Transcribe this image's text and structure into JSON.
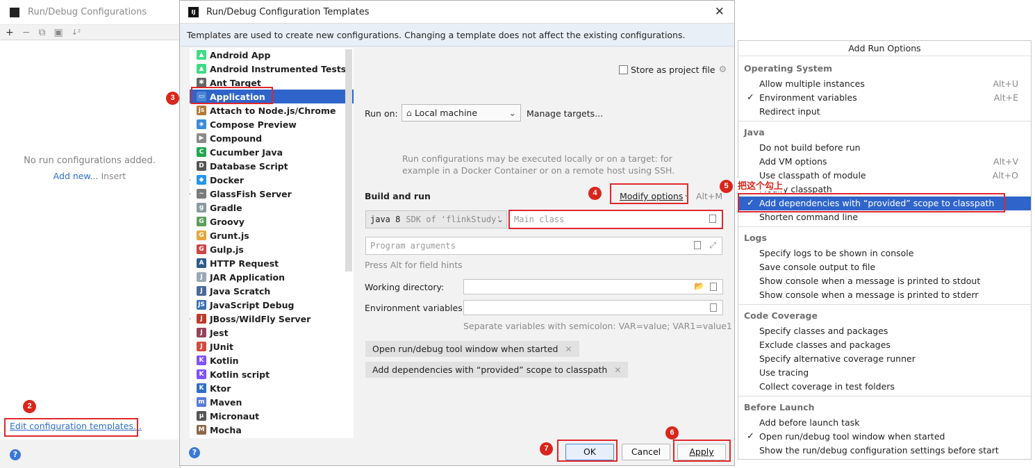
{
  "background_window": {
    "title": "Run/Debug Configurations",
    "toolbar": [
      "+",
      "−",
      "⧉",
      "▣",
      "↓²"
    ],
    "empty_text": "No run configurations added.",
    "add_new": "Add new...",
    "insert_hint": "Insert",
    "edit_templates_link": "Edit configuration templates..."
  },
  "dialog": {
    "title": "Run/Debug Configuration Templates",
    "banner": "Templates are used to create new configurations. Changing a template does not affect the existing configurations.",
    "tree": [
      {
        "label": "Android App",
        "icon": "android-icon",
        "color": "#3ddc84"
      },
      {
        "label": "Android Instrumented Tests",
        "icon": "android-test-icon",
        "color": "#3ddc84"
      },
      {
        "label": "Ant Target",
        "icon": "ant-icon",
        "color": "#666666"
      },
      {
        "label": "Application",
        "icon": "application-icon",
        "color": "#4a86d8",
        "selected": true
      },
      {
        "label": "Attach to Node.js/Chrome",
        "icon": "nodejs-icon",
        "color": "#b07a3a"
      },
      {
        "label": "Compose Preview",
        "icon": "compose-icon",
        "color": "#3b8ad8"
      },
      {
        "label": "Compound",
        "icon": "compound-icon",
        "color": "#8a8a8a"
      },
      {
        "label": "Cucumber Java",
        "icon": "cucumber-icon",
        "color": "#23a650"
      },
      {
        "label": "Database Script",
        "icon": "database-icon",
        "color": "#555555"
      },
      {
        "label": "Docker",
        "icon": "docker-icon",
        "color": "#2496ed",
        "expandable": true
      },
      {
        "label": "GlassFish Server",
        "icon": "glassfish-icon",
        "color": "#7a7a7a",
        "expandable": true
      },
      {
        "label": "Gradle",
        "icon": "gradle-icon",
        "color": "#8a9aa0"
      },
      {
        "label": "Groovy",
        "icon": "groovy-icon",
        "color": "#5aa05a"
      },
      {
        "label": "Grunt.js",
        "icon": "grunt-icon",
        "color": "#e4a73b"
      },
      {
        "label": "Gulp.js",
        "icon": "gulp-icon",
        "color": "#cf4647"
      },
      {
        "label": "HTTP Request",
        "icon": "api-icon",
        "color": "#2d5b8a"
      },
      {
        "label": "JAR Application",
        "icon": "jar-icon",
        "color": "#9aa8b8"
      },
      {
        "label": "Java Scratch",
        "icon": "java-scratch-icon",
        "color": "#4a6a9a"
      },
      {
        "label": "JavaScript Debug",
        "icon": "js-debug-icon",
        "color": "#3b6fb0"
      },
      {
        "label": "JBoss/WildFly Server",
        "icon": "jboss-icon",
        "color": "#c0392b",
        "expandable": true
      },
      {
        "label": "Jest",
        "icon": "jest-icon",
        "color": "#99425b"
      },
      {
        "label": "JUnit",
        "icon": "junit-icon",
        "color": "#d24b3e"
      },
      {
        "label": "Kotlin",
        "icon": "kotlin-icon",
        "color": "#7f52ff"
      },
      {
        "label": "Kotlin script",
        "icon": "kotlin-script-icon",
        "color": "#7f52ff"
      },
      {
        "label": "Ktor",
        "icon": "ktor-icon",
        "color": "#2e6ec7"
      },
      {
        "label": "Maven",
        "icon": "maven-icon",
        "color": "#5a7bd8"
      },
      {
        "label": "Micronaut",
        "icon": "micronaut-icon",
        "color": "#555555"
      },
      {
        "label": "Mocha",
        "icon": "mocha-icon",
        "color": "#8d6748"
      }
    ],
    "store_as_project_file": "Store as project file",
    "run_on_label": "Run on:",
    "run_on_value": "Local machine",
    "manage_targets": "Manage targets...",
    "run_on_help_1": "Run configurations may be executed locally or on a target: for",
    "run_on_help_2": "example in a Docker Container or on a remote host using SSH.",
    "build_and_run": "Build and run",
    "modify_options": "Modify options",
    "modify_shortcut": "Alt+M",
    "jdk_value": "java 8",
    "jdk_hint": "SDK of 'flinkStudy'",
    "main_class_placeholder": "Main class",
    "program_args_placeholder": "Program arguments",
    "field_hints": "Press Alt for field hints",
    "working_dir_label": "Working directory:",
    "env_vars_label": "Environment variables:",
    "env_vars_hint": "Separate variables with semicolon: VAR=value; VAR1=value1",
    "chips": [
      "Open run/debug tool window when started",
      "Add dependencies with “provided” scope to classpath"
    ],
    "ok": "OK",
    "cancel": "Cancel",
    "apply": "Apply"
  },
  "popup": {
    "title": "Add Run Options",
    "sections": [
      {
        "title": "Operating System",
        "items": [
          {
            "label": "Allow multiple instances",
            "shortcut": "Alt+U",
            "checked": false
          },
          {
            "label": "Environment variables",
            "shortcut": "Alt+E",
            "checked": true
          },
          {
            "label": "Redirect input",
            "shortcut": "",
            "checked": false
          }
        ]
      },
      {
        "title": "Java",
        "items": [
          {
            "label": "Do not build before run",
            "shortcut": "",
            "checked": false
          },
          {
            "label": "Add VM options",
            "shortcut": "Alt+V",
            "checked": false
          },
          {
            "label": "Use classpath of module",
            "shortcut": "Alt+O",
            "checked": false
          },
          {
            "label": "Modify classpath",
            "shortcut": "",
            "checked": false
          },
          {
            "label": "Add dependencies with “provided” scope to classpath",
            "shortcut": "",
            "checked": true,
            "selected": true
          },
          {
            "label": "Shorten command line",
            "shortcut": "",
            "checked": false
          }
        ]
      },
      {
        "title": "Logs",
        "items": [
          {
            "label": "Specify logs to be shown in console",
            "shortcut": "",
            "checked": false
          },
          {
            "label": "Save console output to file",
            "shortcut": "",
            "checked": false
          },
          {
            "label": "Show console when a message is printed to stdout",
            "shortcut": "",
            "checked": false
          },
          {
            "label": "Show console when a message is printed to stderr",
            "shortcut": "",
            "checked": false
          }
        ]
      },
      {
        "title": "Code Coverage",
        "items": [
          {
            "label": "Specify classes and packages",
            "shortcut": "",
            "checked": false
          },
          {
            "label": "Exclude classes and packages",
            "shortcut": "",
            "checked": false
          },
          {
            "label": "Specify alternative coverage runner",
            "shortcut": "",
            "checked": false
          },
          {
            "label": "Use tracing",
            "shortcut": "",
            "checked": false
          },
          {
            "label": "Collect coverage in test folders",
            "shortcut": "",
            "checked": false
          }
        ]
      },
      {
        "title": "Before Launch",
        "items": [
          {
            "label": "Add before launch task",
            "shortcut": "",
            "checked": false
          },
          {
            "label": "Open run/debug tool window when started",
            "shortcut": "",
            "checked": true
          },
          {
            "label": "Show the run/debug configuration settings before start",
            "shortcut": "",
            "checked": false
          }
        ]
      }
    ]
  },
  "annotations": {
    "badges": [
      "2",
      "3",
      "4",
      "5",
      "6",
      "7"
    ],
    "note_check_this": "把这个勾上"
  },
  "colors": {
    "selection": "#2f65ca",
    "annotation_red": "#e0262c",
    "link": "#2e6ec7"
  }
}
